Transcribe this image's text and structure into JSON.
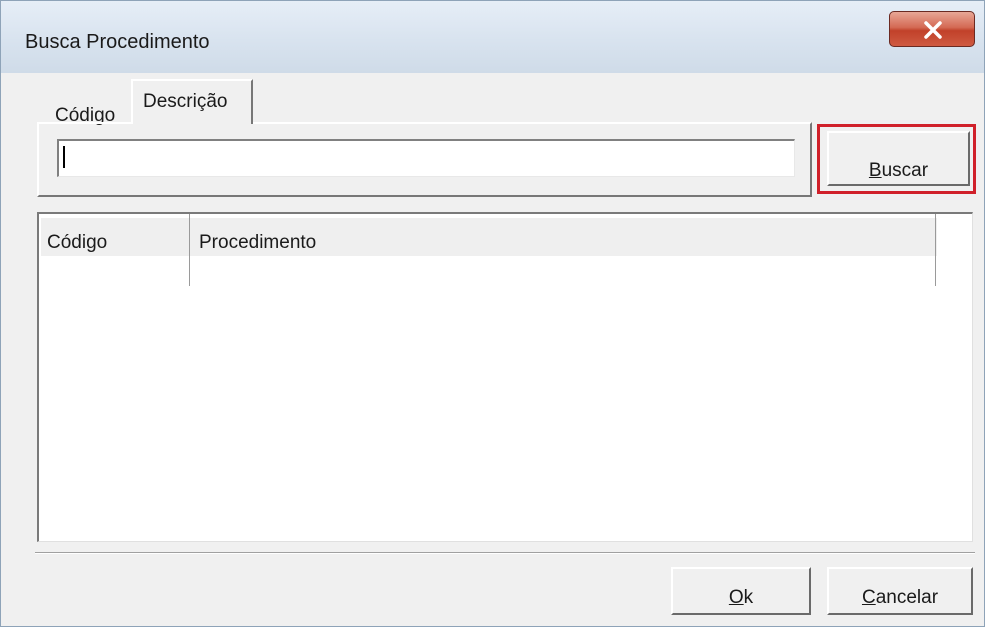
{
  "window": {
    "title": "Busca Procedimento",
    "close_icon": "close-x-icon"
  },
  "tabs": [
    {
      "label": "Código",
      "active": false
    },
    {
      "label": "Descrição",
      "active": true
    }
  ],
  "search": {
    "value": ""
  },
  "buttons": {
    "buscar": {
      "label": "Buscar",
      "mnemonic": "B",
      "rest": "uscar"
    },
    "ok": {
      "label": "Ok",
      "mnemonic": "O",
      "rest": "k"
    },
    "cancelar": {
      "label": "Cancelar",
      "mnemonic": "C",
      "rest": "ancelar"
    }
  },
  "results_table": {
    "columns": [
      "Código",
      "Procedimento"
    ],
    "rows": []
  },
  "colors": {
    "highlight": "#d0202a",
    "close_button": "#c1412a"
  }
}
